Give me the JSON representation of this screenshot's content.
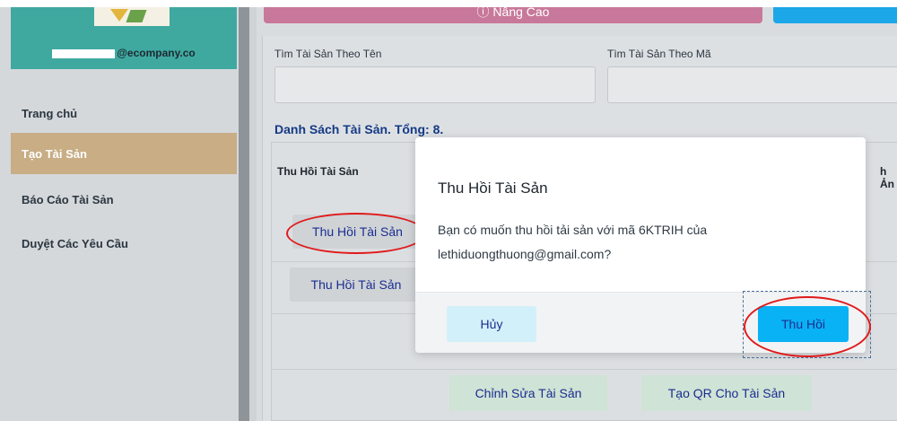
{
  "sidebar": {
    "user_email": "@ecompany.co",
    "items": [
      {
        "label": "Trang chủ"
      },
      {
        "label": "Tạo Tài Sản"
      },
      {
        "label": "Báo Cáo Tài Sản"
      },
      {
        "label": "Duyệt Các Yêu Cầu"
      }
    ]
  },
  "toolbar": {
    "advanced_label": "Nâng Cao"
  },
  "search": {
    "name_label": "Tìm Tài Sản Theo Tên",
    "code_label": "Tìm Tài Sản Theo Mã"
  },
  "list": {
    "title": "Danh Sách Tài Sản. Tổng: 8.",
    "col_recall": "Thu Hồi Tài Sản",
    "col_image_partial": "h Ản",
    "row_recall_1": "Thu Hồi Tài Sản",
    "row_recall_2": "Thu Hồi Tài Sản",
    "edit_label": "Chỉnh Sửa Tài Sản",
    "qr_label": "Tạo QR Cho Tài Sản"
  },
  "modal": {
    "title": "Thu Hồi Tài Sản",
    "message": "Bạn có muốn thu hồi tải sản với mã 6KTRIH của lethiduongthuong@gmail.com?",
    "cancel_label": "Hủy",
    "confirm_label": "Thu Hồi"
  },
  "colors": {
    "sidebar_header": "#3fa9a0",
    "active_nav": "#c8ad85",
    "accent_pink": "#c8789a",
    "accent_blue": "#09b2f5",
    "title_blue": "#143a86",
    "annotation_red": "#e01a1a"
  }
}
